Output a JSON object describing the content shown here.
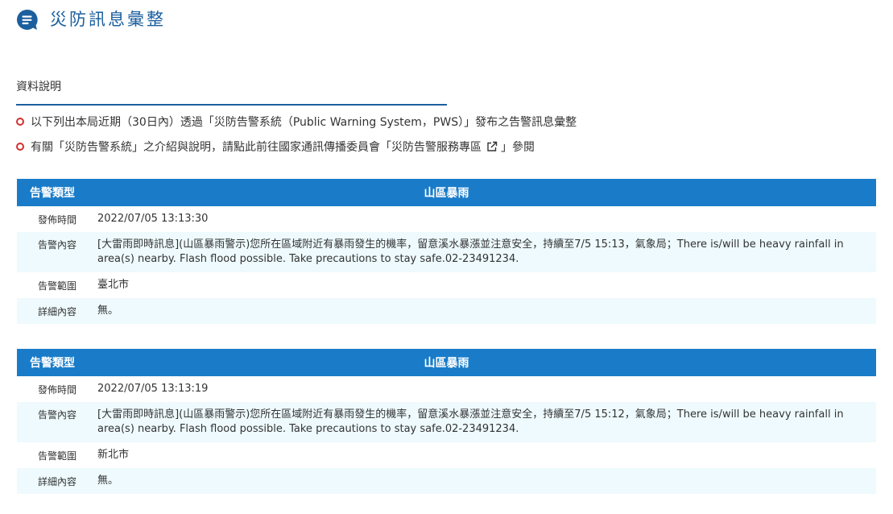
{
  "header": {
    "title": "災防訊息彙整",
    "icon": "speech-bubble-list-icon",
    "icon_color": "#1b5f9e"
  },
  "section": {
    "title": "資料說明",
    "notes": [
      "以下列出本局近期（30日內）透過「災防告警系統（Public Warning System，PWS）」發布之告警訊息彙整",
      {
        "before": "有關「災防告警系統」之介紹與說明，請點此前往國家通訊傳播委員會",
        "link": "「災防告警服務專區",
        "after": "」參閱"
      }
    ]
  },
  "alerts": [
    {
      "type_label": "告警類型",
      "type_value": "山區暴雨",
      "rows": [
        {
          "label": "發佈時間",
          "value": "2022/07/05 13:13:30"
        },
        {
          "label": "告警內容",
          "value": "[大雷雨即時訊息](山區暴雨警示)您所在區域附近有暴雨發生的機率，留意溪水暴漲並注意安全，持續至7/5 15:13，氣象局；There is/will be heavy rainfall in area(s) nearby. Flash flood possible. Take precautions to stay safe.02-23491234."
        },
        {
          "label": "告警範圍",
          "value": "臺北市"
        },
        {
          "label": "詳細內容",
          "value": "無。"
        }
      ]
    },
    {
      "type_label": "告警類型",
      "type_value": "山區暴雨",
      "rows": [
        {
          "label": "發佈時間",
          "value": "2022/07/05 13:13:19"
        },
        {
          "label": "告警內容",
          "value": "[大雷雨即時訊息](山區暴雨警示)您所在區域附近有暴雨發生的機率，留意溪水暴漲並注意安全，持續至7/5 15:12，氣象局；There is/will be heavy rainfall in area(s) nearby. Flash flood possible. Take precautions to stay safe.02-23491234."
        },
        {
          "label": "告警範圍",
          "value": "新北市"
        },
        {
          "label": "詳細內容",
          "value": "無。"
        }
      ]
    }
  ],
  "colors": {
    "accent": "#1a7cc8",
    "title": "#1b5f9e",
    "bullet": "#d32f2f",
    "alt_row": "#eefafd"
  }
}
